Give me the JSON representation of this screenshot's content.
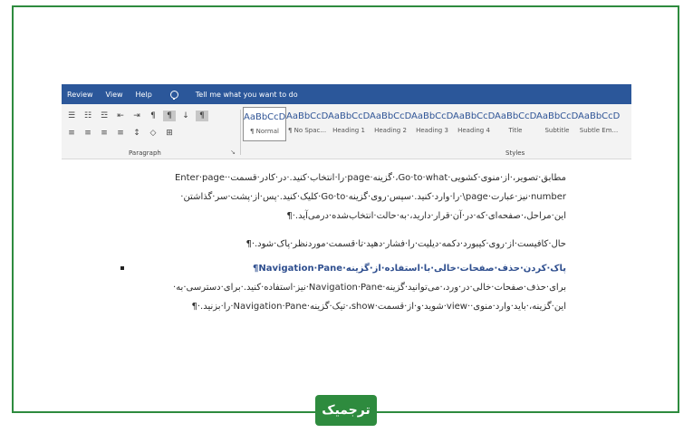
{
  "ribbon": {
    "tabs": [
      "Review",
      "View",
      "Help"
    ],
    "tell_me": "Tell me what you want to do",
    "paragraph_label": "Paragraph",
    "styles_label": "Styles",
    "styles": [
      {
        "sample": "AaBbCcDdEe",
        "name": "¶ Normal"
      },
      {
        "sample": "AaBbCcDdEe",
        "name": "¶ No Spac..."
      },
      {
        "sample": "AaBbCcDdEe",
        "name": "Heading 1"
      },
      {
        "sample": "AaBbCcDdEe",
        "name": "Heading 2"
      },
      {
        "sample": "AaBbCcDdEe",
        "name": "Heading 3"
      },
      {
        "sample": "AaBbCcDdEe",
        "name": "Heading 4"
      },
      {
        "sample": "AaBbCcDdEe",
        "name": "Title"
      },
      {
        "sample": "AaBbCcDdEe",
        "name": "Subtitle"
      },
      {
        "sample": "AaBbCcDdEe",
        "name": "Subtle Em..."
      }
    ]
  },
  "document": {
    "lines": [
      "مطابق·تصویر،·از·منوی·کشویی·Go·to·what،·گزینه·page·را·انتخاب·کنید.·در·کادر·قسمت··Enter·page",
      "number·نیز·عبارت·page\\·را·وارد·کنید.·سپس·روی·گزینه·Go·to·کلیک·کنید.·پس·از·پشت·سر·گذاشتن·",
      "این·مراحل،·صفحه‌ای·که·در·آن·قرار·دارید،·به·حالت·انتخاب‌شده·درمی‌آید.·¶",
      "حال·کافیست·از·روی·کیبورد·دکمه·دیلیت·را·فشار·دهید·تا·قسمت·موردنظر·پاک·شود.·¶",
      "پاک·کردن·حذف·صفحات·خالی·با·استفاده·از·گزینه·Navigation·Pane¶",
      "برای·حذف·صفحات·خالی·در·ورد،·می‌توانید·گزینه·Navigation·Pane·نیز·استفاده·کنید.·برای·دسترسی·به·",
      "این·گزینه،·باید·وارد·منوی··view·شوید·و·از·قسمت·show،·تیک·گزینه·Navigation·Pane·را·بزنید.·¶"
    ]
  },
  "logo_text": "ترجمیک",
  "colors": {
    "frame": "#2e8b3e",
    "ribbon": "#2b579a"
  }
}
